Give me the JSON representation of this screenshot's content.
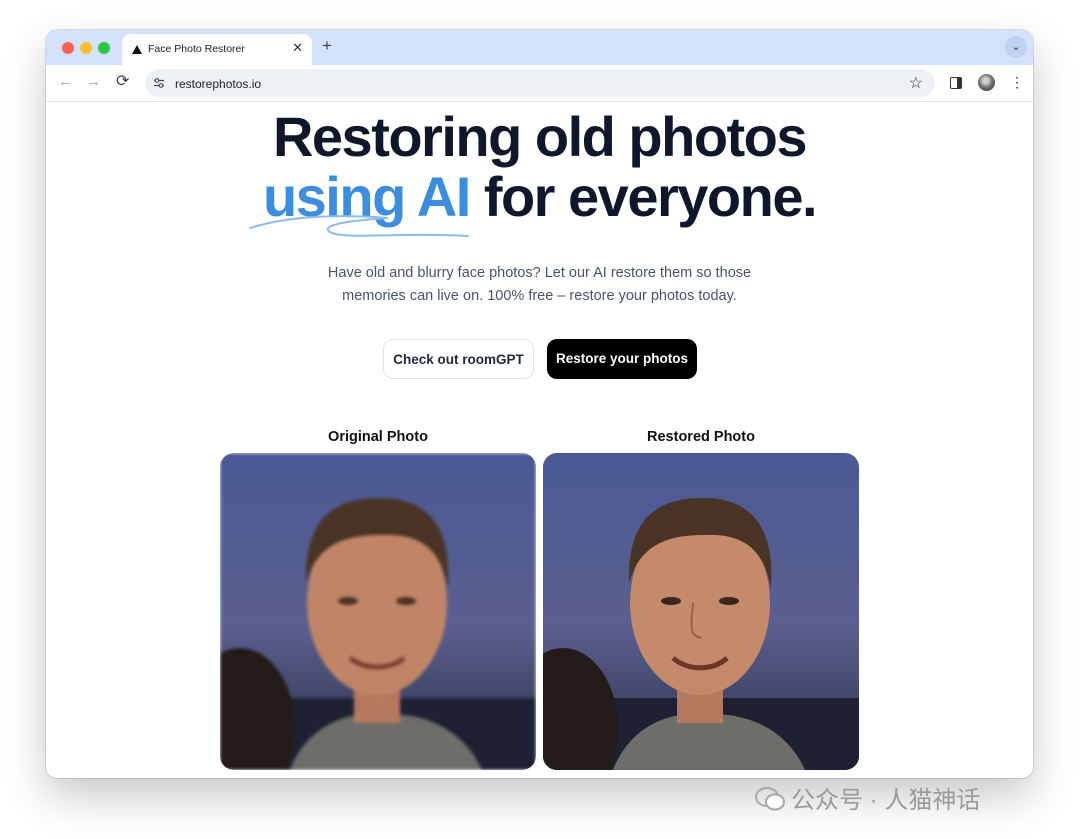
{
  "browser": {
    "tab_title": "Face Photo Restorer",
    "tab_close": "✕",
    "new_tab": "+",
    "tab_search": "⌄",
    "nav_back": "←",
    "nav_forward": "→",
    "nav_reload": "⟳",
    "url": "restorephotos.io",
    "bookmark_star": "☆",
    "menu": "⋮"
  },
  "hero": {
    "line1": "Restoring old photos",
    "line2_accent": "using AI",
    "line2_rest": " for everyone.",
    "accent_color": "#3b8de0"
  },
  "subtitle": {
    "line1": "Have old and blurry face photos? Let our AI restore them so those",
    "line2": "memories can live on. 100% free – restore your photos today."
  },
  "buttons": {
    "secondary_label": "Check out roomGPT",
    "primary_label": "Restore your photos"
  },
  "photos": {
    "original_label": "Original Photo",
    "restored_label": "Restored Photo"
  },
  "watermark": {
    "text": "公众号 · 人猫神话"
  }
}
